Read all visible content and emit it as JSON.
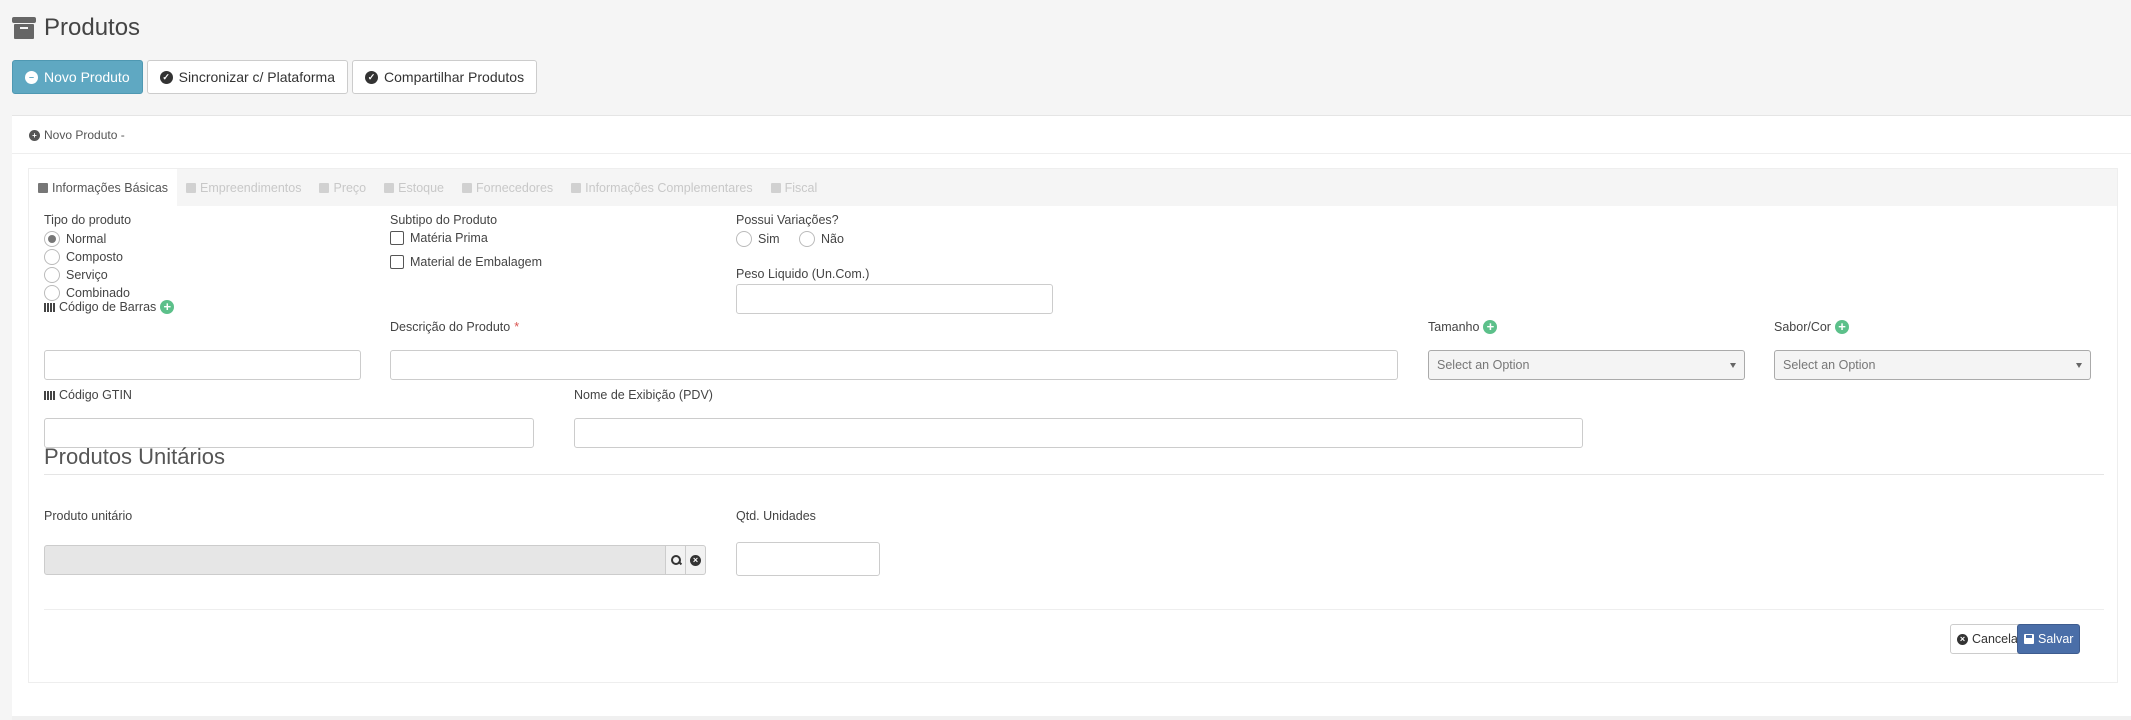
{
  "page": {
    "title": "Produtos",
    "title_icon": "archive-icon"
  },
  "actions": {
    "new_product": "Novo Produto",
    "sync_platform": "Sincronizar c/ Plataforma",
    "share_products": "Compartilhar Produtos"
  },
  "breadcrumb": {
    "label": "Novo Produto -"
  },
  "tabs": [
    {
      "label": "Informações Básicas",
      "active": true
    },
    {
      "label": "Empreendimentos",
      "active": false
    },
    {
      "label": "Preço",
      "active": false
    },
    {
      "label": "Estoque",
      "active": false
    },
    {
      "label": "Fornecedores",
      "active": false
    },
    {
      "label": "Informações Complementares",
      "active": false
    },
    {
      "label": "Fiscal",
      "active": false
    }
  ],
  "form": {
    "tipo_label": "Tipo do produto",
    "tipo_options": [
      "Normal",
      "Composto",
      "Serviço",
      "Combinado"
    ],
    "tipo_selected": "Normal",
    "subtipo_label": "Subtipo do Produto",
    "subtipo_options": [
      "Matéria Prima",
      "Material de Embalagem"
    ],
    "variacoes_label": "Possui Variações?",
    "variacoes_options": [
      "Sim",
      "Não"
    ],
    "peso_label": "Peso Liquido (Un.Com.)",
    "barcode_label": "Código de Barras",
    "descricao_label": "Descrição do Produto",
    "required_mark": "*",
    "tamanho_label": "Tamanho",
    "tamanho_placeholder": "Select an Option",
    "sabor_label": "Sabor/Cor",
    "sabor_placeholder": "Select an Option",
    "gtin_label": "Código GTIN",
    "nome_pdv_label": "Nome de Exibição (PDV)"
  },
  "unitarios": {
    "section_title": "Produtos Unitários",
    "produto_label": "Produto unitário",
    "qtd_label": "Qtd. Unidades"
  },
  "footer": {
    "cancel": "Cancelar",
    "save": "Salvar"
  },
  "colors": {
    "primary": "#5fa8c2",
    "save": "#4a6ea8",
    "add": "#5cc08a",
    "required": "#d9534f"
  }
}
